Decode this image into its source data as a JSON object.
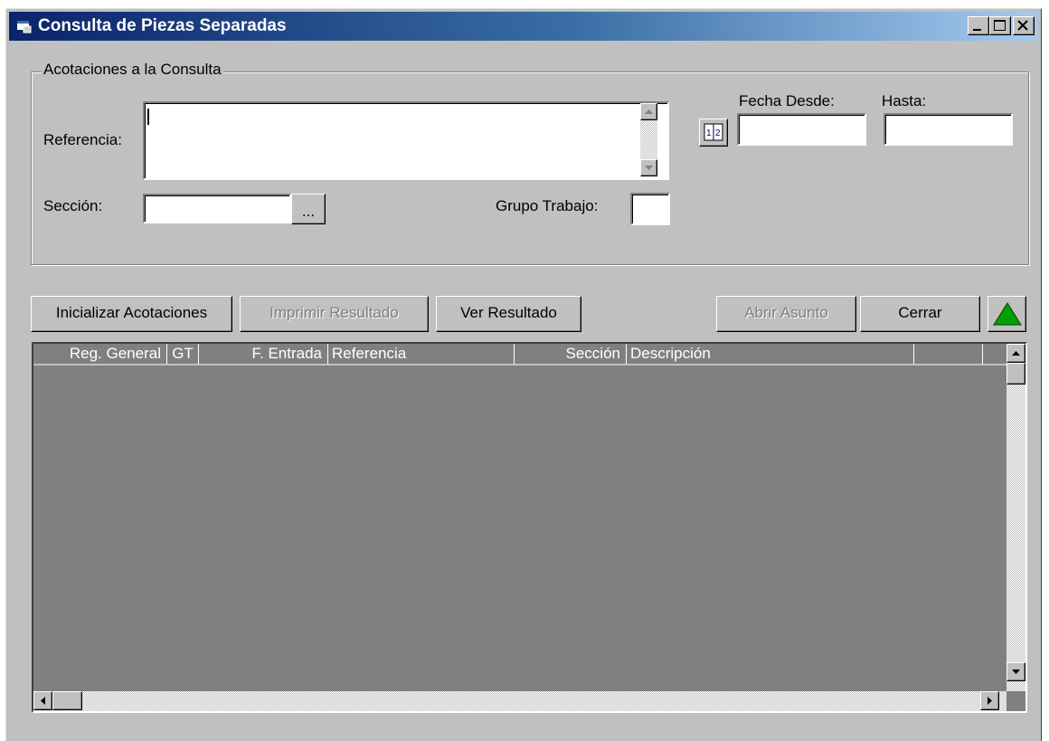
{
  "window": {
    "title": "Consulta de Piezas Separadas",
    "icon": "app-icon",
    "controls": [
      "minimize-icon",
      "maximize-icon",
      "close-icon"
    ]
  },
  "group": {
    "legend": "Acotaciones a la Consulta"
  },
  "form": {
    "referencia_label": "Referencia:",
    "referencia_value": "",
    "seccion_label": "Sección:",
    "seccion_value": "",
    "seccion_browse": "...",
    "grupo_label": "Grupo Trabajo:",
    "grupo_value": "",
    "fecha_desde_label": "Fecha  Desde:",
    "fecha_desde_value": "",
    "hasta_label": "Hasta:",
    "hasta_value": "",
    "calendar_icon": "calendar-icon"
  },
  "buttons": {
    "inicializar": "Inicializar Acotaciones",
    "imprimir": "Imprimir Resultado",
    "ver": "Ver Resultado",
    "abrir": "Abrir Asunto",
    "cerrar": "Cerrar",
    "up_icon": "triangle-up-icon"
  },
  "grid": {
    "columns": [
      "Reg. General",
      "GT",
      "F. Entrada",
      "Referencia",
      "Sección",
      "Descripción",
      ""
    ],
    "rows": []
  },
  "colors": {
    "title_start": "#0a246a",
    "title_end": "#a6caf0",
    "face": "#c0c0c0",
    "grid_bg": "#808080",
    "up_arrow": "#00a000"
  }
}
